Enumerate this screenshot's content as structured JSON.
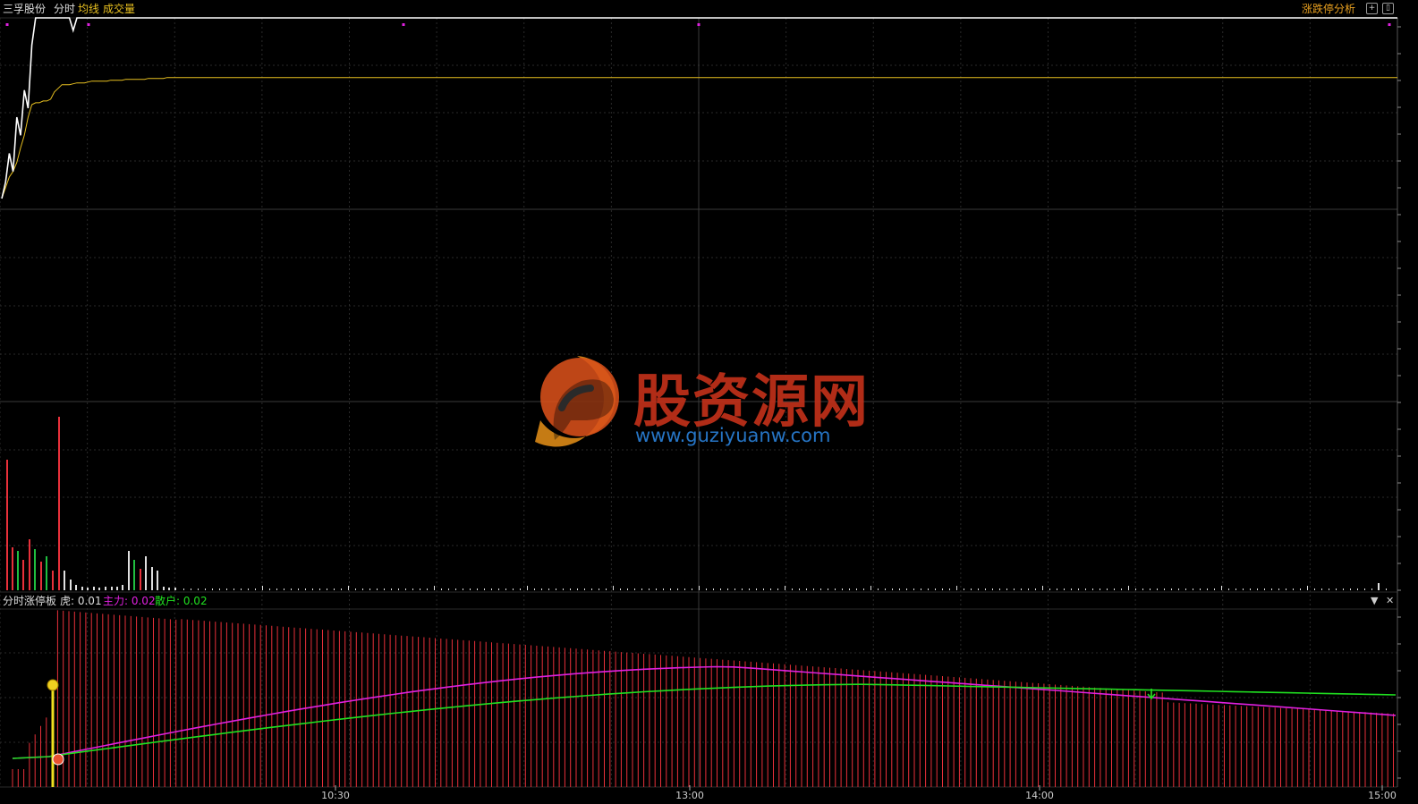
{
  "header": {
    "stock_name": "三孚股份",
    "mode": "分时",
    "avg_line": "均线",
    "volume": "成交量",
    "analysis": "涨跌停分析",
    "plus_icon": "plus-icon",
    "window_icon": "window-icon"
  },
  "indicator": {
    "name": "分时涨停板",
    "hu_label": "虎: 0.01",
    "main_label": "主力: 0.02",
    "retail_label": "散户: 0.02",
    "dropdown_icon": "dropdown-icon",
    "close_icon": "close-icon"
  },
  "watermark": {
    "text": "股资源网",
    "url": "www.guziyuanw.com"
  },
  "time_axis": {
    "labels": [
      "10:30",
      "13:00",
      "14:00",
      "15:00"
    ]
  },
  "colors": {
    "price_line": "#ffffff",
    "avg_line": "#e8c020",
    "volume_up": "#e8303a",
    "volume_down": "#20c040",
    "main_force": "#e020e0",
    "retail": "#20e020",
    "grid": "#2a2a2a"
  },
  "chart_data": {
    "type": "line",
    "series": [
      {
        "name": "分时",
        "values": [
          0.0,
          0.9,
          2.5,
          1.5,
          4.5,
          3.5,
          6.0,
          5.0,
          8.5,
          10.0,
          10.0,
          10.0,
          10.0,
          10.0,
          10.0,
          10.0,
          10.0,
          10.0,
          10.0,
          9.3,
          10.0,
          10.0,
          10.0,
          10.0,
          10.0,
          10.0,
          10.0,
          10.0,
          10.0,
          10.0,
          10.0,
          10.0,
          10.0,
          10.0,
          10.0,
          10.0,
          10.0,
          10.0,
          10.0,
          10.0,
          10.0,
          10.0,
          10.0,
          10.0,
          10.0,
          10.0,
          10.0,
          10.0,
          10.0,
          10.0
        ]
      },
      {
        "name": "均线",
        "values": [
          0.0,
          0.6,
          1.2,
          1.5,
          2.0,
          2.8,
          3.5,
          4.5,
          5.2,
          5.3,
          5.3,
          5.4,
          5.4,
          5.5,
          5.9,
          6.1,
          6.3,
          6.3,
          6.3,
          6.35,
          6.4,
          6.4,
          6.4,
          6.45,
          6.5,
          6.5,
          6.5,
          6.5,
          6.5,
          6.55,
          6.55,
          6.55,
          6.55,
          6.6,
          6.6,
          6.6,
          6.6,
          6.6,
          6.6,
          6.65,
          6.65,
          6.65,
          6.65,
          6.65,
          6.7,
          6.7,
          6.7,
          6.7,
          6.7,
          6.7
        ]
      }
    ]
  }
}
